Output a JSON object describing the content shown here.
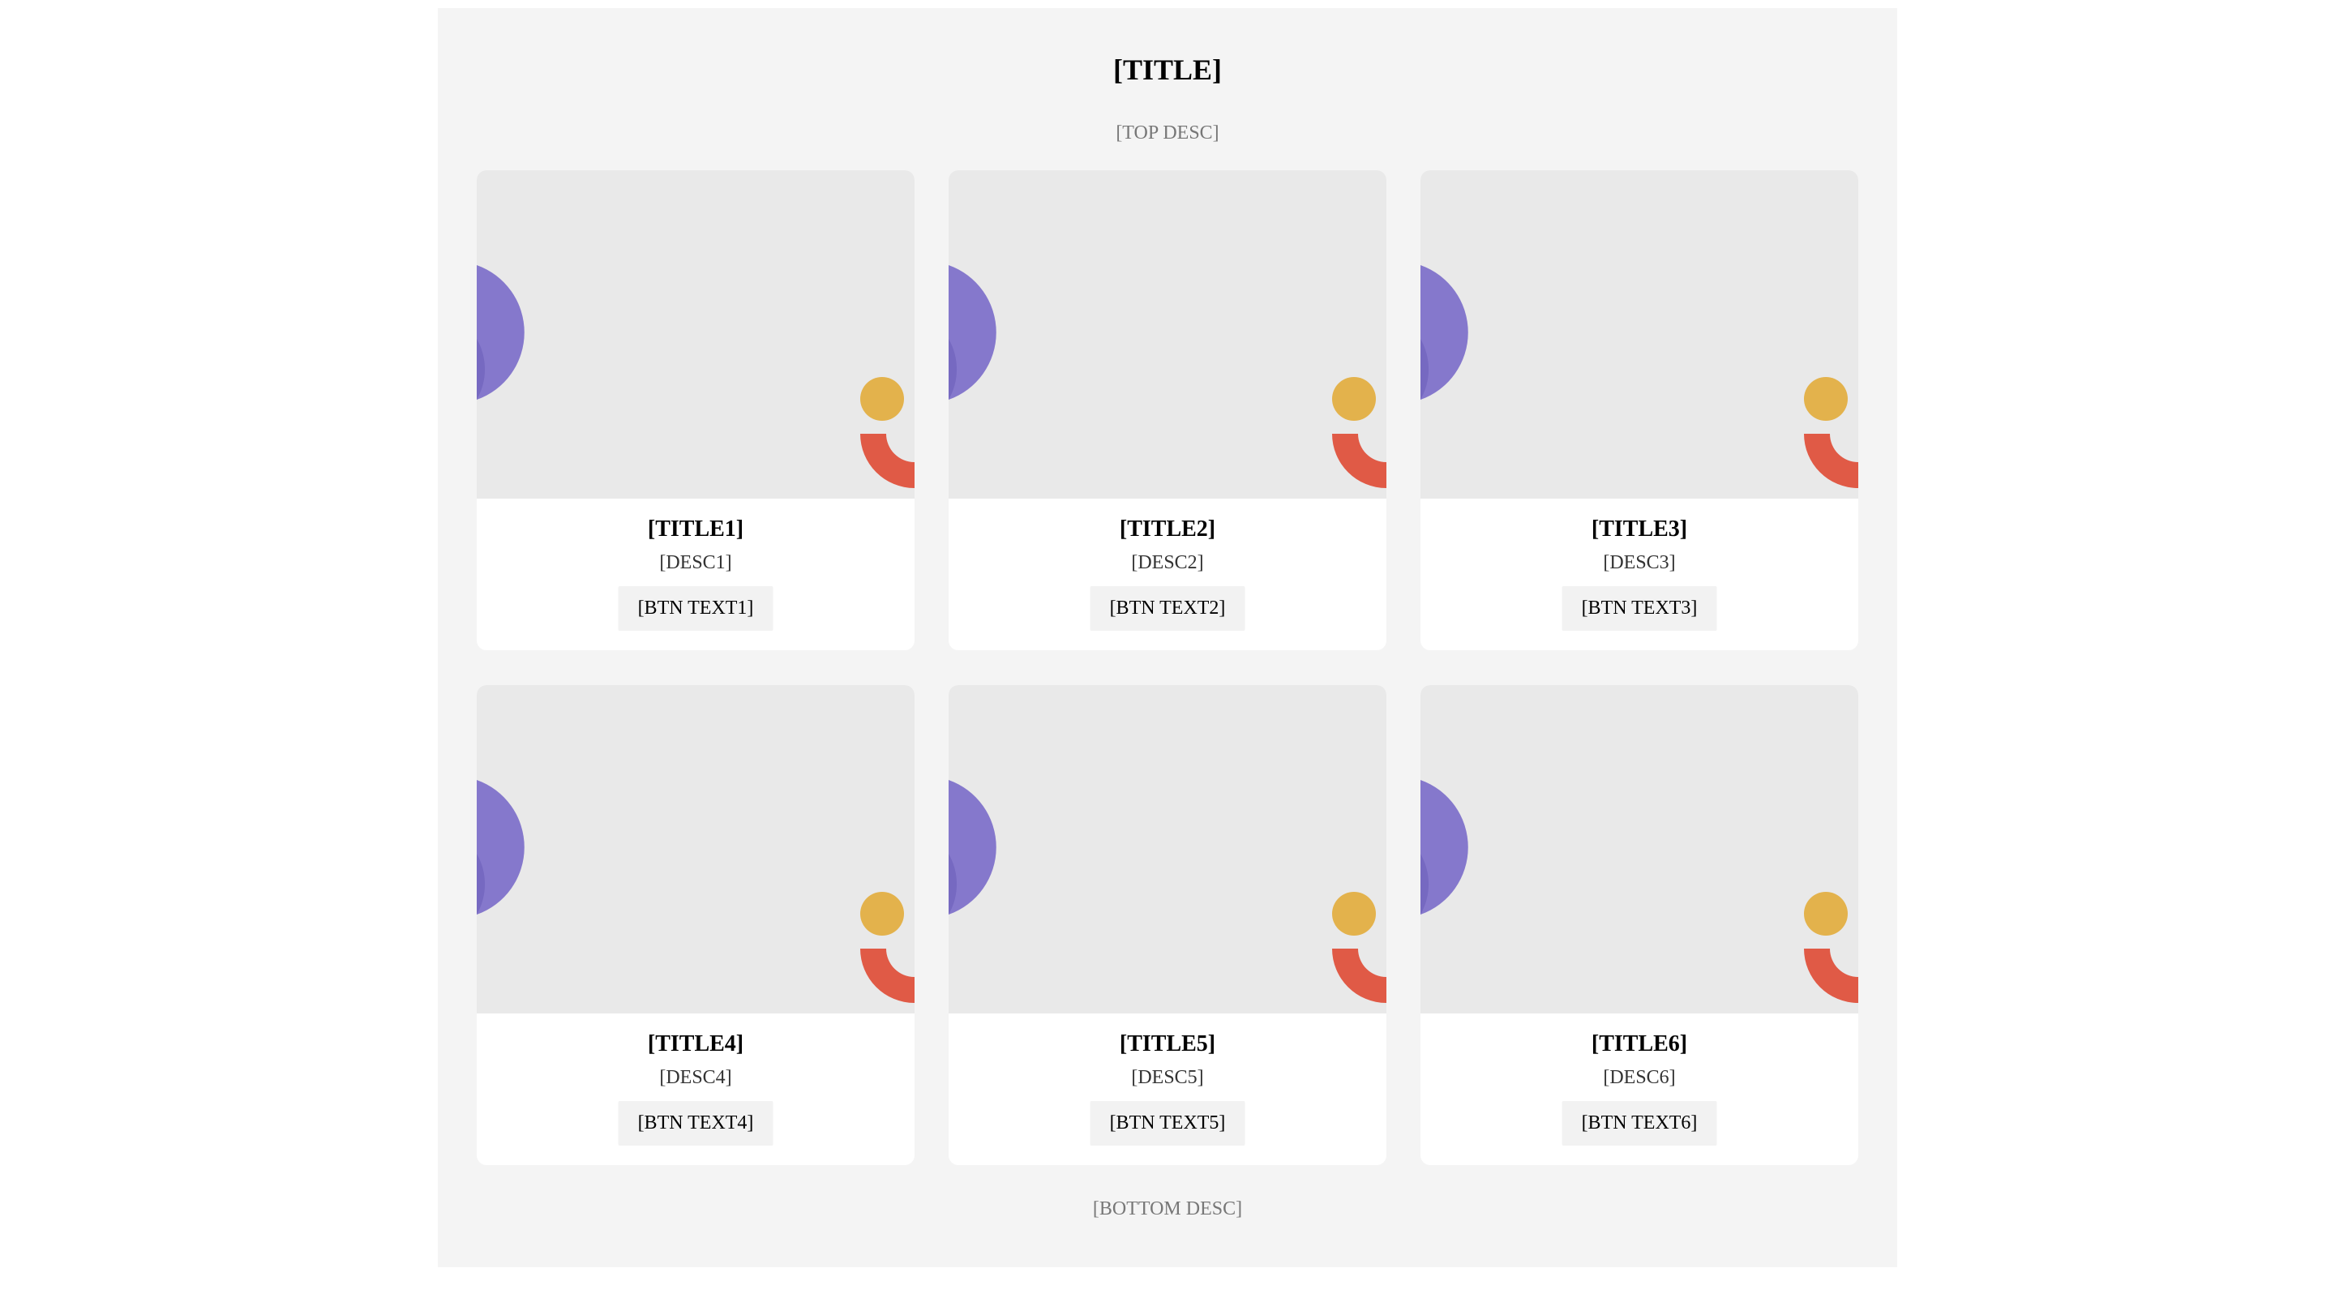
{
  "page": {
    "title": "[TITLE]",
    "top_desc": "[TOP DESC]",
    "bottom_desc": "[BOTTOM DESC]"
  },
  "colors": {
    "frame_bg": "#f4f4f4",
    "art_bg": "#e9e9e9",
    "purple_shape": "#7f72c9",
    "purple_shape_dark": "#6a5cb8",
    "yellow_dot": "#e3b24c",
    "red_arc": "#e05a46",
    "button_bg": "#f2f2f2"
  },
  "cards": [
    {
      "title": "[TITLE1]",
      "desc": "[DESC1]",
      "button": "[BTN TEXT1]"
    },
    {
      "title": "[TITLE2]",
      "desc": "[DESC2]",
      "button": "[BTN TEXT2]"
    },
    {
      "title": "[TITLE3]",
      "desc": "[DESC3]",
      "button": "[BTN TEXT3]"
    },
    {
      "title": "[TITLE4]",
      "desc": "[DESC4]",
      "button": "[BTN TEXT4]"
    },
    {
      "title": "[TITLE5]",
      "desc": "[DESC5]",
      "button": "[BTN TEXT5]"
    },
    {
      "title": "[TITLE6]",
      "desc": "[DESC6]",
      "button": "[BTN TEXT6]"
    }
  ]
}
